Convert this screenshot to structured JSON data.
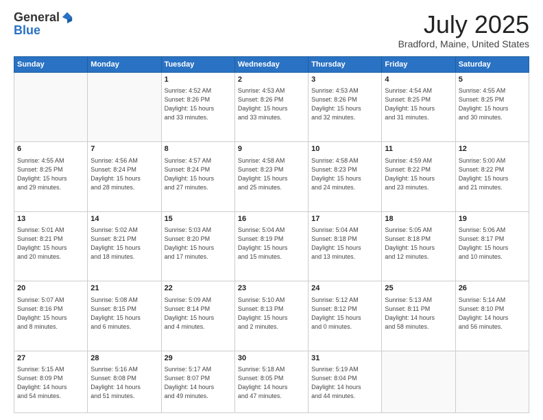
{
  "logo": {
    "general": "General",
    "blue": "Blue"
  },
  "header": {
    "title": "July 2025",
    "subtitle": "Bradford, Maine, United States"
  },
  "days_of_week": [
    "Sunday",
    "Monday",
    "Tuesday",
    "Wednesday",
    "Thursday",
    "Friday",
    "Saturday"
  ],
  "weeks": [
    [
      {
        "day": "",
        "info": ""
      },
      {
        "day": "",
        "info": ""
      },
      {
        "day": "1",
        "info": "Sunrise: 4:52 AM\nSunset: 8:26 PM\nDaylight: 15 hours\nand 33 minutes."
      },
      {
        "day": "2",
        "info": "Sunrise: 4:53 AM\nSunset: 8:26 PM\nDaylight: 15 hours\nand 33 minutes."
      },
      {
        "day": "3",
        "info": "Sunrise: 4:53 AM\nSunset: 8:26 PM\nDaylight: 15 hours\nand 32 minutes."
      },
      {
        "day": "4",
        "info": "Sunrise: 4:54 AM\nSunset: 8:25 PM\nDaylight: 15 hours\nand 31 minutes."
      },
      {
        "day": "5",
        "info": "Sunrise: 4:55 AM\nSunset: 8:25 PM\nDaylight: 15 hours\nand 30 minutes."
      }
    ],
    [
      {
        "day": "6",
        "info": "Sunrise: 4:55 AM\nSunset: 8:25 PM\nDaylight: 15 hours\nand 29 minutes."
      },
      {
        "day": "7",
        "info": "Sunrise: 4:56 AM\nSunset: 8:24 PM\nDaylight: 15 hours\nand 28 minutes."
      },
      {
        "day": "8",
        "info": "Sunrise: 4:57 AM\nSunset: 8:24 PM\nDaylight: 15 hours\nand 27 minutes."
      },
      {
        "day": "9",
        "info": "Sunrise: 4:58 AM\nSunset: 8:23 PM\nDaylight: 15 hours\nand 25 minutes."
      },
      {
        "day": "10",
        "info": "Sunrise: 4:58 AM\nSunset: 8:23 PM\nDaylight: 15 hours\nand 24 minutes."
      },
      {
        "day": "11",
        "info": "Sunrise: 4:59 AM\nSunset: 8:22 PM\nDaylight: 15 hours\nand 23 minutes."
      },
      {
        "day": "12",
        "info": "Sunrise: 5:00 AM\nSunset: 8:22 PM\nDaylight: 15 hours\nand 21 minutes."
      }
    ],
    [
      {
        "day": "13",
        "info": "Sunrise: 5:01 AM\nSunset: 8:21 PM\nDaylight: 15 hours\nand 20 minutes."
      },
      {
        "day": "14",
        "info": "Sunrise: 5:02 AM\nSunset: 8:21 PM\nDaylight: 15 hours\nand 18 minutes."
      },
      {
        "day": "15",
        "info": "Sunrise: 5:03 AM\nSunset: 8:20 PM\nDaylight: 15 hours\nand 17 minutes."
      },
      {
        "day": "16",
        "info": "Sunrise: 5:04 AM\nSunset: 8:19 PM\nDaylight: 15 hours\nand 15 minutes."
      },
      {
        "day": "17",
        "info": "Sunrise: 5:04 AM\nSunset: 8:18 PM\nDaylight: 15 hours\nand 13 minutes."
      },
      {
        "day": "18",
        "info": "Sunrise: 5:05 AM\nSunset: 8:18 PM\nDaylight: 15 hours\nand 12 minutes."
      },
      {
        "day": "19",
        "info": "Sunrise: 5:06 AM\nSunset: 8:17 PM\nDaylight: 15 hours\nand 10 minutes."
      }
    ],
    [
      {
        "day": "20",
        "info": "Sunrise: 5:07 AM\nSunset: 8:16 PM\nDaylight: 15 hours\nand 8 minutes."
      },
      {
        "day": "21",
        "info": "Sunrise: 5:08 AM\nSunset: 8:15 PM\nDaylight: 15 hours\nand 6 minutes."
      },
      {
        "day": "22",
        "info": "Sunrise: 5:09 AM\nSunset: 8:14 PM\nDaylight: 15 hours\nand 4 minutes."
      },
      {
        "day": "23",
        "info": "Sunrise: 5:10 AM\nSunset: 8:13 PM\nDaylight: 15 hours\nand 2 minutes."
      },
      {
        "day": "24",
        "info": "Sunrise: 5:12 AM\nSunset: 8:12 PM\nDaylight: 15 hours\nand 0 minutes."
      },
      {
        "day": "25",
        "info": "Sunrise: 5:13 AM\nSunset: 8:11 PM\nDaylight: 14 hours\nand 58 minutes."
      },
      {
        "day": "26",
        "info": "Sunrise: 5:14 AM\nSunset: 8:10 PM\nDaylight: 14 hours\nand 56 minutes."
      }
    ],
    [
      {
        "day": "27",
        "info": "Sunrise: 5:15 AM\nSunset: 8:09 PM\nDaylight: 14 hours\nand 54 minutes."
      },
      {
        "day": "28",
        "info": "Sunrise: 5:16 AM\nSunset: 8:08 PM\nDaylight: 14 hours\nand 51 minutes."
      },
      {
        "day": "29",
        "info": "Sunrise: 5:17 AM\nSunset: 8:07 PM\nDaylight: 14 hours\nand 49 minutes."
      },
      {
        "day": "30",
        "info": "Sunrise: 5:18 AM\nSunset: 8:05 PM\nDaylight: 14 hours\nand 47 minutes."
      },
      {
        "day": "31",
        "info": "Sunrise: 5:19 AM\nSunset: 8:04 PM\nDaylight: 14 hours\nand 44 minutes."
      },
      {
        "day": "",
        "info": ""
      },
      {
        "day": "",
        "info": ""
      }
    ]
  ]
}
